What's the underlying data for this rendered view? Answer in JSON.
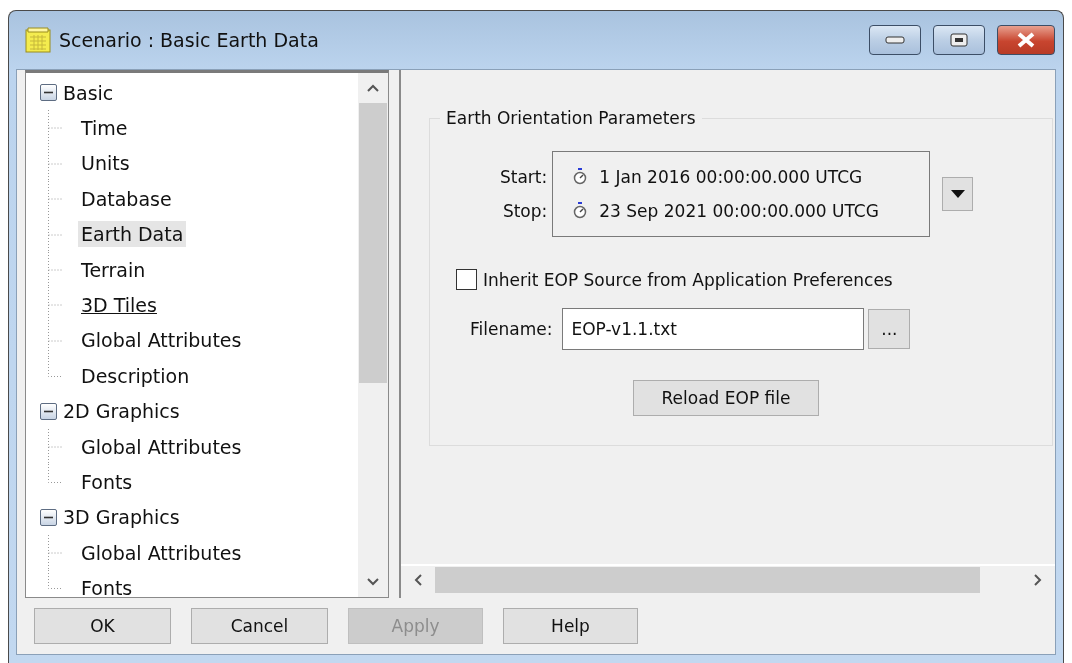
{
  "window": {
    "title": "Scenario : Basic Earth Data"
  },
  "tree": [
    {
      "label": "Basic",
      "expanded": true,
      "selected": false,
      "children": [
        {
          "label": "Time",
          "selected": false,
          "hovered": false
        },
        {
          "label": "Units",
          "selected": false,
          "hovered": false
        },
        {
          "label": "Database",
          "selected": false,
          "hovered": false
        },
        {
          "label": "Earth Data",
          "selected": true,
          "hovered": false
        },
        {
          "label": "Terrain",
          "selected": false,
          "hovered": false
        },
        {
          "label": "3D Tiles",
          "selected": false,
          "hovered": true
        },
        {
          "label": "Global Attributes",
          "selected": false,
          "hovered": false
        },
        {
          "label": "Description",
          "selected": false,
          "hovered": false
        }
      ]
    },
    {
      "label": "2D Graphics",
      "expanded": true,
      "selected": false,
      "children": [
        {
          "label": "Global Attributes",
          "selected": false,
          "hovered": false
        },
        {
          "label": "Fonts",
          "selected": false,
          "hovered": false
        }
      ]
    },
    {
      "label": "3D Graphics",
      "expanded": true,
      "selected": false,
      "children": [
        {
          "label": "Global Attributes",
          "selected": false,
          "hovered": false
        },
        {
          "label": "Fonts",
          "selected": false,
          "hovered": false
        }
      ]
    }
  ],
  "eop": {
    "title": "Earth Orientation Parameters",
    "times": [
      {
        "label": "Start:",
        "value": "1 Jan 2016 00:00:00.000 UTCG"
      },
      {
        "label": "Stop:",
        "value": "23 Sep 2021 00:00:00.000 UTCG"
      }
    ],
    "inherit": {
      "label": "Inherit EOP Source from Application Preferences",
      "checked": false
    },
    "filename": {
      "label": "Filename:",
      "value": "EOP-v1.1.txt",
      "browse": "..."
    },
    "reload": "Reload EOP file"
  },
  "buttons": [
    {
      "label": "OK",
      "disabled": false
    },
    {
      "label": "Cancel",
      "disabled": false
    },
    {
      "label": "Apply",
      "disabled": true
    },
    {
      "label": "Help",
      "disabled": false
    }
  ]
}
